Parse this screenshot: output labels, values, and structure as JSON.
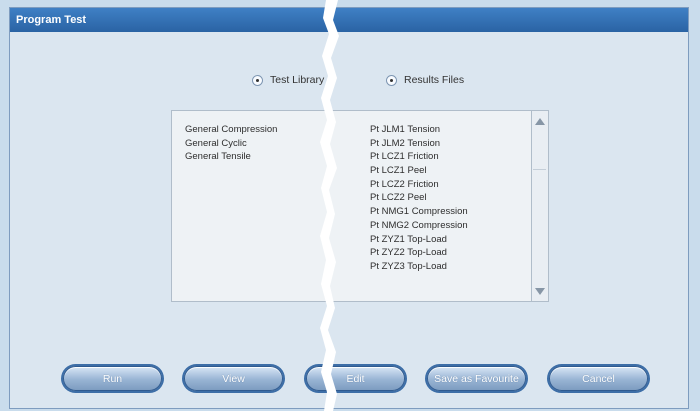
{
  "window": {
    "title": "Program Test"
  },
  "radios": {
    "test_library": "Test Library",
    "results_files": "Results Files"
  },
  "list": {
    "left_items": [
      "General Compression",
      "General Cyclic",
      "General Tensile"
    ],
    "right_items": [
      "Pt JLM1 Tension",
      "Pt JLM2 Tension",
      "Pt LCZ1 Friction",
      "Pt LCZ1 Peel",
      "Pt LCZ2 Friction",
      "Pt LCZ2 Peel",
      "Pt NMG1 Compression",
      "Pt NMG2 Compression",
      "Pt ZYZ1 Top-Load",
      "Pt ZYZ2 Top-Load",
      "Pt ZYZ3 Top-Load"
    ]
  },
  "buttons": {
    "run": "Run",
    "view": "View",
    "edit": "Edit",
    "save_favourite": "Save as Favourite",
    "cancel": "Cancel"
  },
  "colors": {
    "title_bar": "#2f6fb4",
    "background": "#dbe6f0",
    "button_fill": "#98b4d4",
    "button_border": "#3d6ea7"
  }
}
